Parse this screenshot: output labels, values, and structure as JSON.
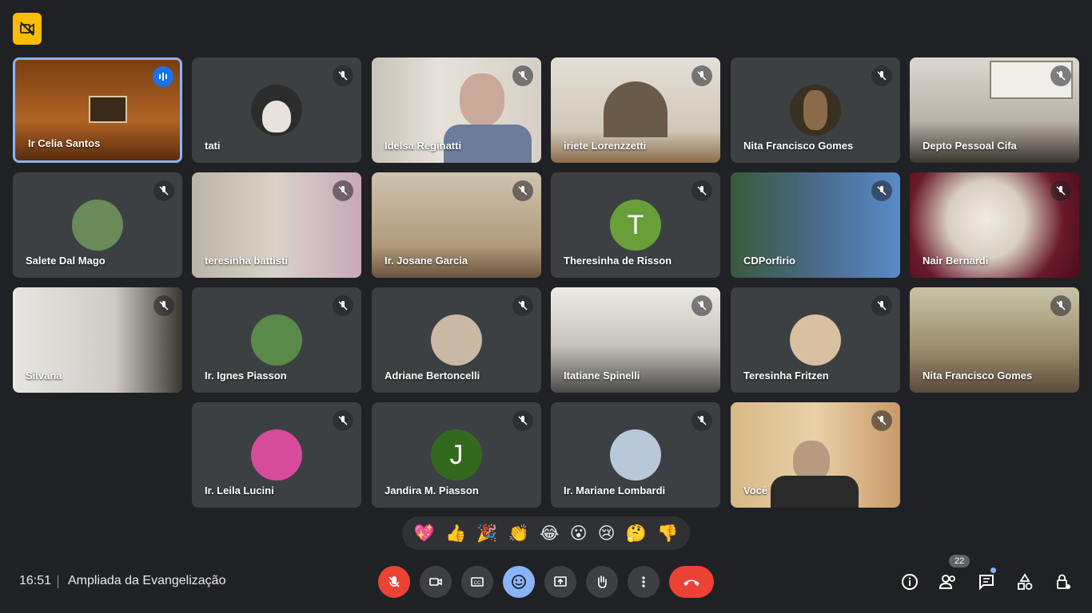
{
  "colors": {
    "background": "#202124",
    "tile": "#3c4043",
    "accent": "#8ab4f8",
    "danger": "#ea4335",
    "badge": "#fbbc04"
  },
  "top_badge_icon": "no-video-recording-icon",
  "participants": [
    {
      "name": "Ir Celia Santos",
      "type": "video",
      "speaking": true
    },
    {
      "name": "tati",
      "type": "avatar"
    },
    {
      "name": "Idelsa Reginatti",
      "type": "video"
    },
    {
      "name": "iriete Lorenzzetti",
      "type": "video"
    },
    {
      "name": "Nita Francisco Gomes",
      "type": "avatar"
    },
    {
      "name": "Depto Pessoal Cifa",
      "type": "video"
    },
    {
      "name": "Salete Dal Mago",
      "type": "avatar"
    },
    {
      "name": "teresinha battisti",
      "type": "video"
    },
    {
      "name": "Ir. Josane Garcia",
      "type": "video"
    },
    {
      "name": "Theresinha de Risson",
      "type": "initial",
      "initial": "T"
    },
    {
      "name": "CDPorfirio",
      "type": "video"
    },
    {
      "name": "Nair Bernardi",
      "type": "video"
    },
    {
      "name": "Silvana",
      "type": "video"
    },
    {
      "name": "Ir. Ignes Piasson",
      "type": "avatar"
    },
    {
      "name": "Adriane Bertoncelli",
      "type": "avatar"
    },
    {
      "name": "Itatiane Spinelli",
      "type": "video"
    },
    {
      "name": "Teresinha Fritzen",
      "type": "avatar"
    },
    {
      "name": "Nita Francisco Gomes",
      "type": "video"
    },
    {
      "name": "Ir. Leila Lucini",
      "type": "avatar"
    },
    {
      "name": "Jandira M. Piasson",
      "type": "initial",
      "initial": "J"
    },
    {
      "name": "Ir. Mariane Lombardi",
      "type": "avatar"
    },
    {
      "name": "Você",
      "type": "video"
    }
  ],
  "reactions": [
    "💖",
    "👍",
    "🎉",
    "👏",
    "😂",
    "😮",
    "😢",
    "🤔",
    "👎"
  ],
  "meeting": {
    "time": "16:51",
    "title": "Ampliada da Evangelização"
  },
  "controls": [
    "mic-off-icon",
    "camera-icon",
    "captions-icon",
    "emoji-icon",
    "present-icon",
    "raise-hand-icon",
    "more-options-icon",
    "end-call-icon"
  ],
  "right_controls": [
    "info-icon",
    "people-icon",
    "chat-icon",
    "activities-icon",
    "host-controls-icon"
  ],
  "people_count": "22"
}
